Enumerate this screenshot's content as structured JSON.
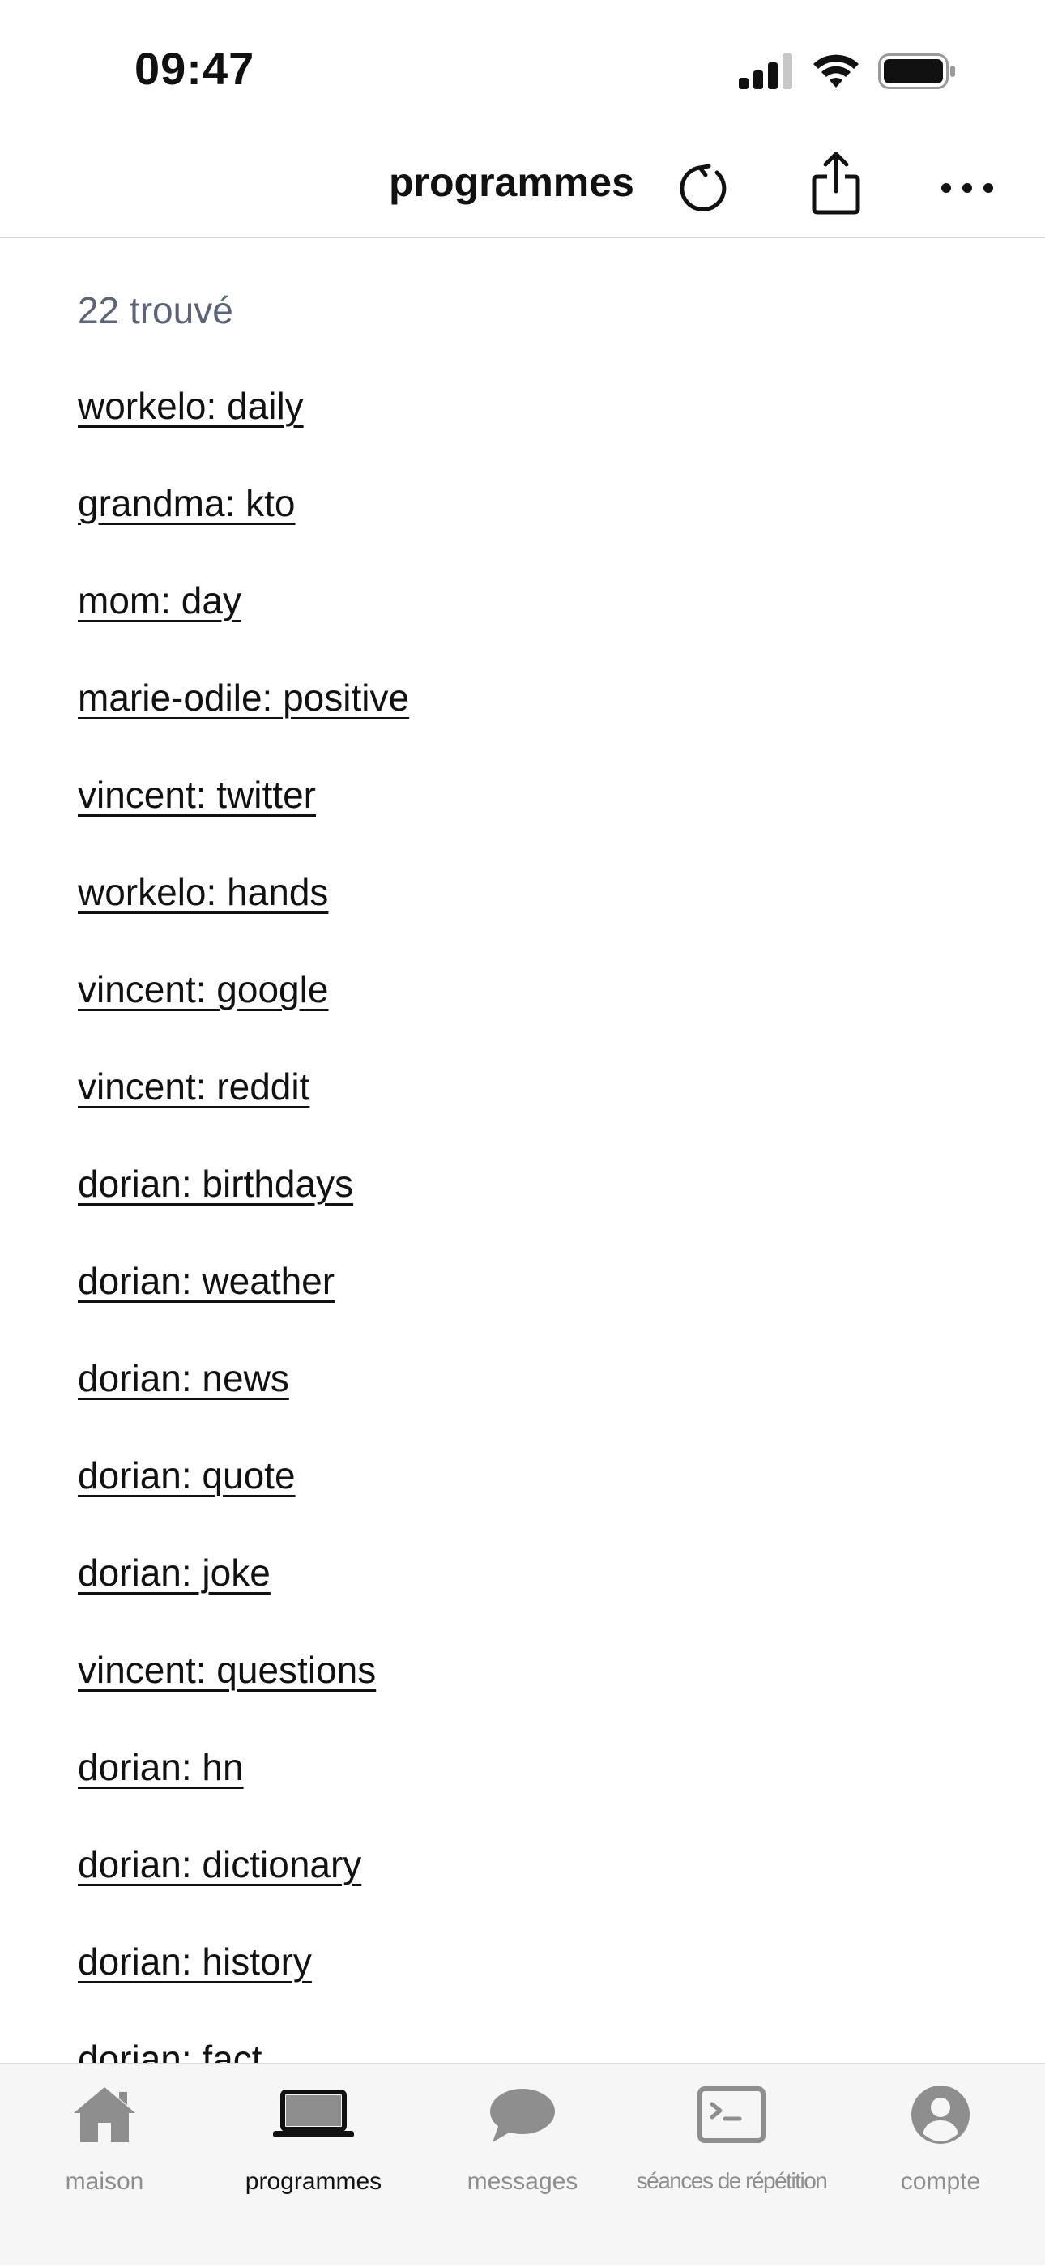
{
  "status": {
    "time": "09:47"
  },
  "header": {
    "title": "programmes",
    "icons": [
      "refresh-icon",
      "share-icon",
      "more-icon"
    ]
  },
  "main": {
    "result_count": "22 trouvé",
    "programs": [
      "workelo: daily",
      "grandma: kto",
      "mom: day",
      "marie-odile: positive",
      "vincent: twitter",
      "workelo: hands",
      "vincent: google",
      "vincent: reddit",
      "dorian: birthdays",
      "dorian: weather",
      "dorian: news",
      "dorian: quote",
      "dorian: joke",
      "vincent: questions",
      "dorian: hn",
      "dorian: dictionary",
      "dorian: history",
      "dorian: fact"
    ]
  },
  "tabbar": {
    "tabs": [
      {
        "label": "maison",
        "icon": "house-icon",
        "active": false
      },
      {
        "label": "programmes",
        "icon": "laptop-icon",
        "active": true
      },
      {
        "label": "messages",
        "icon": "chat-bubble-icon",
        "active": false
      },
      {
        "label": "séances de répétition",
        "icon": "terminal-icon",
        "active": false
      },
      {
        "label": "compte",
        "icon": "user-circle-icon",
        "active": false
      }
    ]
  },
  "colors": {
    "text": "#111111",
    "muted": "#5b6478",
    "tab_inactive": "#8e8e8e",
    "tab_bar_bg": "#f6f6f6"
  }
}
